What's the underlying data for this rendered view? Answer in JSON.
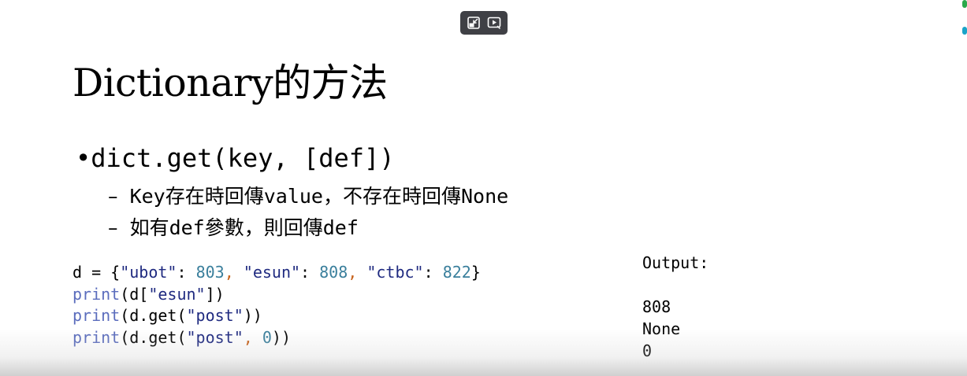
{
  "slide": {
    "title": "Dictionary的方法",
    "bullet": "dict.get(key, [def])",
    "bullet_marker": "•",
    "subpoints": [
      {
        "dash": "–",
        "text": "Key存在時回傳value，不存在時回傳None"
      },
      {
        "dash": "–",
        "text": "如有def參數，則回傳def"
      }
    ],
    "code": {
      "line1": {
        "var": "d = {",
        "k1": "\"ubot\"",
        "sep1": ": ",
        "v1": "803",
        "c1": ", ",
        "k2": "\"esun\"",
        "sep2": ": ",
        "v2": "808",
        "c2": ", ",
        "k3": "\"ctbc\"",
        "sep3": ": ",
        "v3": "822",
        "end": "}"
      },
      "line2": {
        "fn": "print",
        "a": "(d[",
        "s": "\"esun\"",
        "b": "])"
      },
      "line3": {
        "fn": "print",
        "a": "(d.get(",
        "s": "\"post\"",
        "b": "))"
      },
      "line4": {
        "fn": "print",
        "a": "(d.get(",
        "s": "\"post\"",
        "c": ", ",
        "n": "0",
        "b": "))"
      }
    },
    "output": {
      "label": "Output:",
      "lines": [
        "808",
        "None",
        "0"
      ]
    }
  },
  "toolbar": {
    "icons": [
      "exit-pip-icon",
      "play-pip-icon"
    ],
    "background": "#3f4045"
  },
  "colors": {
    "code_function": "#5b6dbd",
    "code_string": "#1f2a80",
    "code_number": "#3a7f9c",
    "code_punctuation": "#c7621b",
    "edge_accent_top": "#2aa84a",
    "edge_accent_bottom": "#1aa3c8"
  }
}
